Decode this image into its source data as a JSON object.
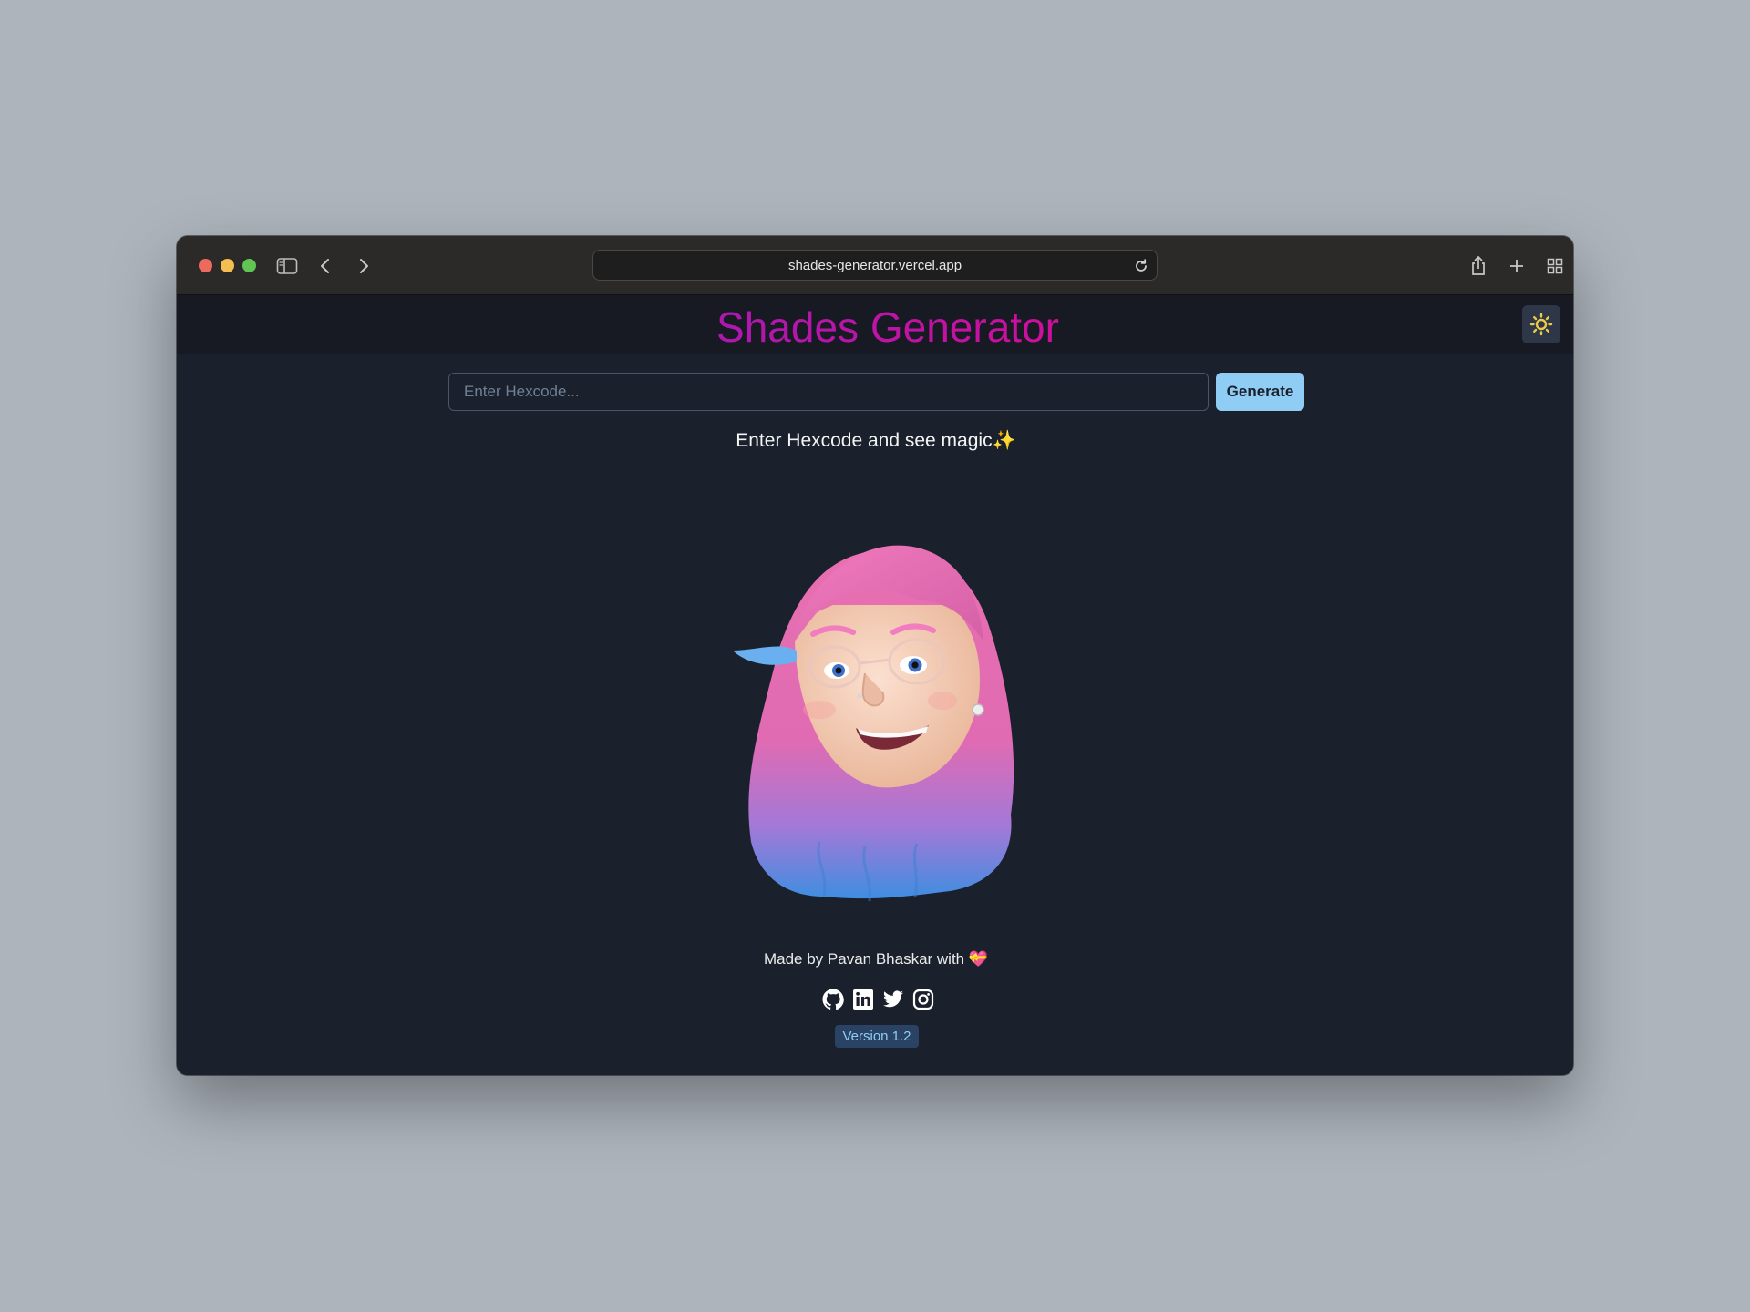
{
  "browser": {
    "url": "shades-generator.vercel.app"
  },
  "header": {
    "title": "Shades Generator",
    "theme_toggle_icon": "sun-icon"
  },
  "form": {
    "placeholder": "Enter Hexcode...",
    "value": "",
    "button_label": "Generate"
  },
  "tagline": "Enter Hexcode and see magic✨",
  "footer": {
    "credit": "Made by Pavan Bhaskar with 💝",
    "socials": [
      "github-icon",
      "linkedin-icon",
      "twitter-icon",
      "instagram-icon"
    ],
    "version": "Version 1.2"
  },
  "colors": {
    "title_gradient": [
      "#7928ca",
      "#ff0080"
    ],
    "accent_button": "#90cdf4",
    "page_background": "#1a202c",
    "header_background": "#171923",
    "sun": "#ecc94b"
  }
}
